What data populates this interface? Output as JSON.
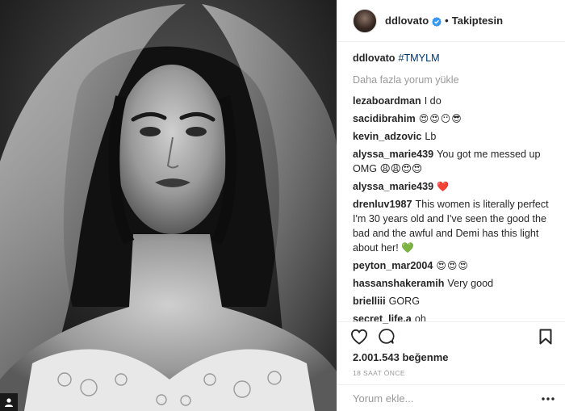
{
  "post_image": {
    "alt": "black and white bridal portrait with veil"
  },
  "header": {
    "username": "ddlovato",
    "separator": "•",
    "follow_status": "Takiptesin"
  },
  "caption": {
    "username": "ddlovato",
    "text": "#TMYLM"
  },
  "load_more": "Daha fazla yorum yükle",
  "comments": [
    {
      "username": "lezaboardman",
      "text": "I do"
    },
    {
      "username": "sacidibrahim",
      "text": "😍😍😶😎"
    },
    {
      "username": "kevin_adzovic",
      "text": "Lb"
    },
    {
      "username": "alyssa_marie439",
      "text": "You got me messed up OMG 😩😩😍😍"
    },
    {
      "username": "alyssa_marie439",
      "text": "❤️"
    },
    {
      "username": "drenluv1987",
      "text": "This women is literally perfect I'm 30 years old and I've seen the good the bad and the awful and Demi has this light about her! 💚"
    },
    {
      "username": "peyton_mar2004",
      "text": "😍😍😍"
    },
    {
      "username": "hassanshakeramih",
      "text": "Very good"
    },
    {
      "username": "brielliii",
      "text": "GORG"
    },
    {
      "username": "secret_life.a",
      "text": "oh"
    }
  ],
  "likes": "2.001.543 beğenme",
  "timestamp": "18 SAAT ÖNCE",
  "add_comment": {
    "placeholder": "Yorum ekle...",
    "value": ""
  },
  "icons": {
    "like": "heart-icon",
    "comment": "comment-bubble-icon",
    "save": "bookmark-icon",
    "menu": "more-dots-icon",
    "verified": "verified-badge-icon",
    "tag": "user-tag-icon"
  },
  "colors": {
    "hashtag": "#003569",
    "verified": "#3897f0",
    "muted": "#999999",
    "border": "#efefef"
  }
}
